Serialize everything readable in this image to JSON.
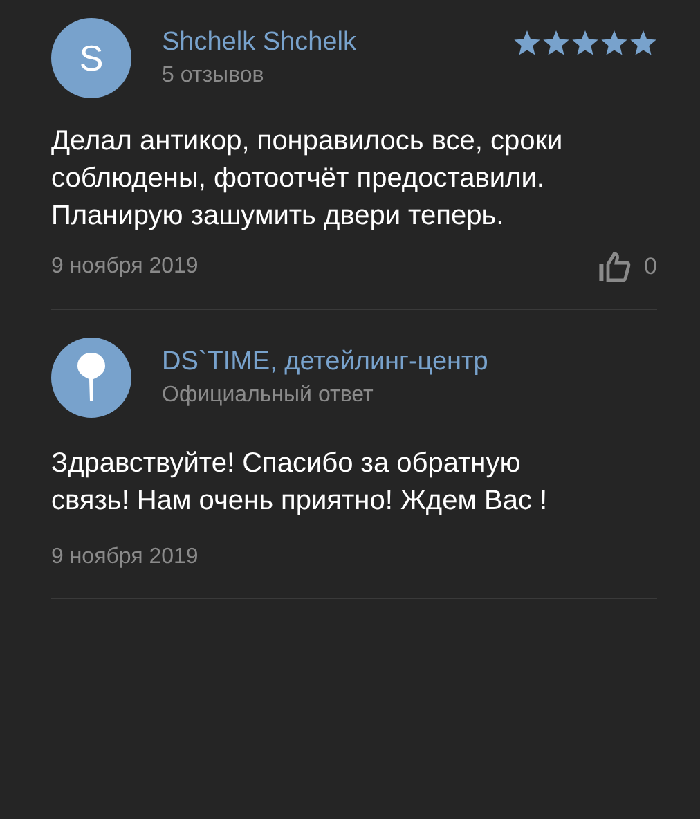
{
  "review": {
    "avatar_letter": "S",
    "author": "Shchelk Shchelk",
    "reviews_count": "5 отзывов",
    "stars": 5,
    "text": "Делал антикор, понравилось все, сроки соблюдены, фотоотчёт предоставили. Планирую зашумить двери теперь.",
    "date": "9 ноября 2019",
    "likes": "0"
  },
  "reply": {
    "author": "DS`TIME, детейлинг-центр",
    "subtitle": "Официальный ответ",
    "text": "Здравствуйте! Спасибо за обратную связь! Нам очень приятно! Ждем Вас !",
    "date": "9 ноября 2019"
  }
}
